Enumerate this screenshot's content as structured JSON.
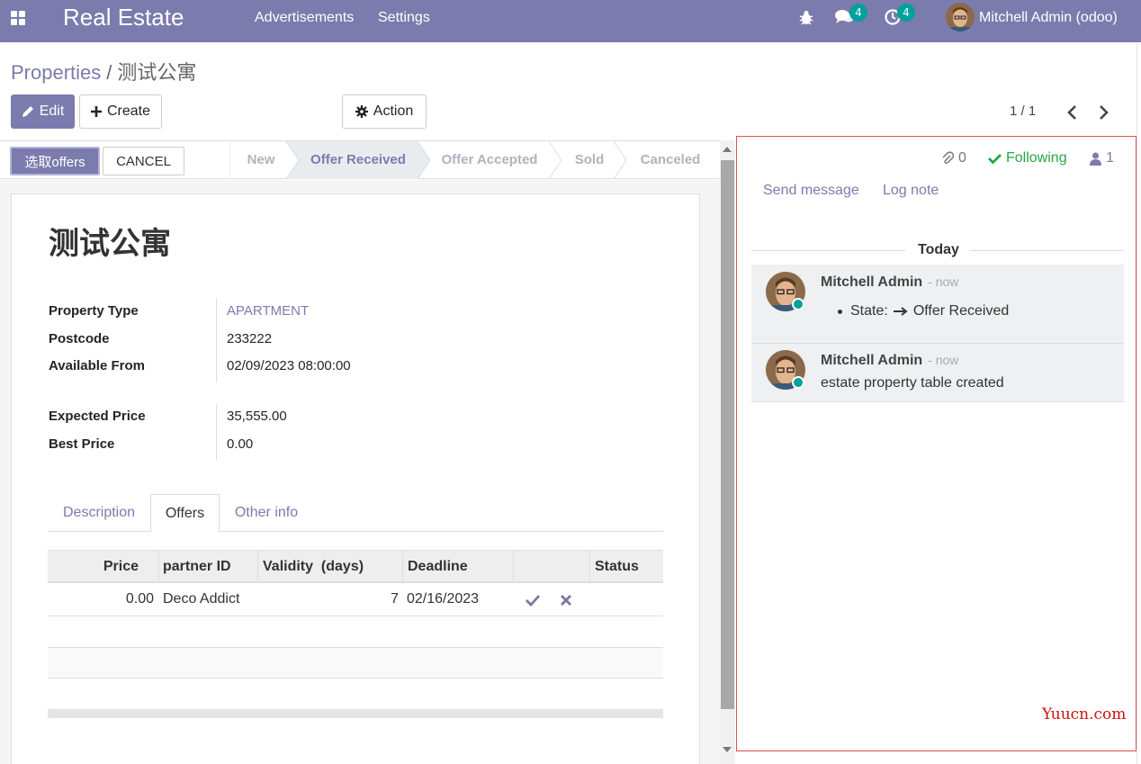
{
  "navbar": {
    "brand": "Real Estate",
    "menu": [
      "Advertisements",
      "Settings"
    ],
    "messages_badge": "4",
    "activities_badge": "4",
    "user": "Mitchell Admin (odoo)",
    "icons": [
      "apps-icon",
      "bug-icon",
      "chat-icon",
      "clock-icon"
    ]
  },
  "breadcrumb": {
    "parent": "Properties",
    "separator": "/",
    "current": "测试公寓"
  },
  "control": {
    "edit_label": "Edit",
    "create_label": "Create",
    "action_label": "Action",
    "pager": "1 / 1"
  },
  "statusbar": {
    "select_offers": "选取offers",
    "cancel": "CANCEL",
    "stages": [
      "New",
      "Offer Received",
      "Offer Accepted",
      "Sold",
      "Canceled"
    ],
    "active_stage": "Offer Received"
  },
  "record": {
    "title": "测试公寓",
    "fields": [
      {
        "label": "Property Type",
        "value": "APARTMENT"
      },
      {
        "label": "Postcode",
        "value": "233222"
      },
      {
        "label": "Available From",
        "value": "02/09/2023 08:00:00"
      },
      {
        "label": "Expected Price",
        "value": "35,555.00"
      },
      {
        "label": "Best Price",
        "value": "0.00"
      }
    ]
  },
  "tabs": [
    "Description",
    "Offers",
    "Other info"
  ],
  "active_tab": "Offers",
  "offers_table": {
    "columns": [
      "Price",
      "partner ID",
      "Validity  (days)",
      "Deadline",
      "",
      "Status"
    ],
    "rows": [
      {
        "price": "0.00",
        "partner": "Deco Addict",
        "validity": "7",
        "deadline": "02/16/2023",
        "status": ""
      }
    ]
  },
  "chatter": {
    "attachments": "0",
    "following": "Following",
    "followers": "1",
    "send_message": "Send message",
    "log_note": "Log note",
    "today": "Today",
    "messages": [
      {
        "author": "Mitchell Admin",
        "time": "- now",
        "tracking_label": "State:",
        "tracking_value": "Offer Received"
      },
      {
        "author": "Mitchell Admin",
        "time": "- now",
        "body": "estate property table created"
      }
    ]
  },
  "watermark": "Yuucn.com",
  "colors": {
    "primary": "#7c7bad",
    "online": "#00a09d",
    "following": "#28a745"
  }
}
